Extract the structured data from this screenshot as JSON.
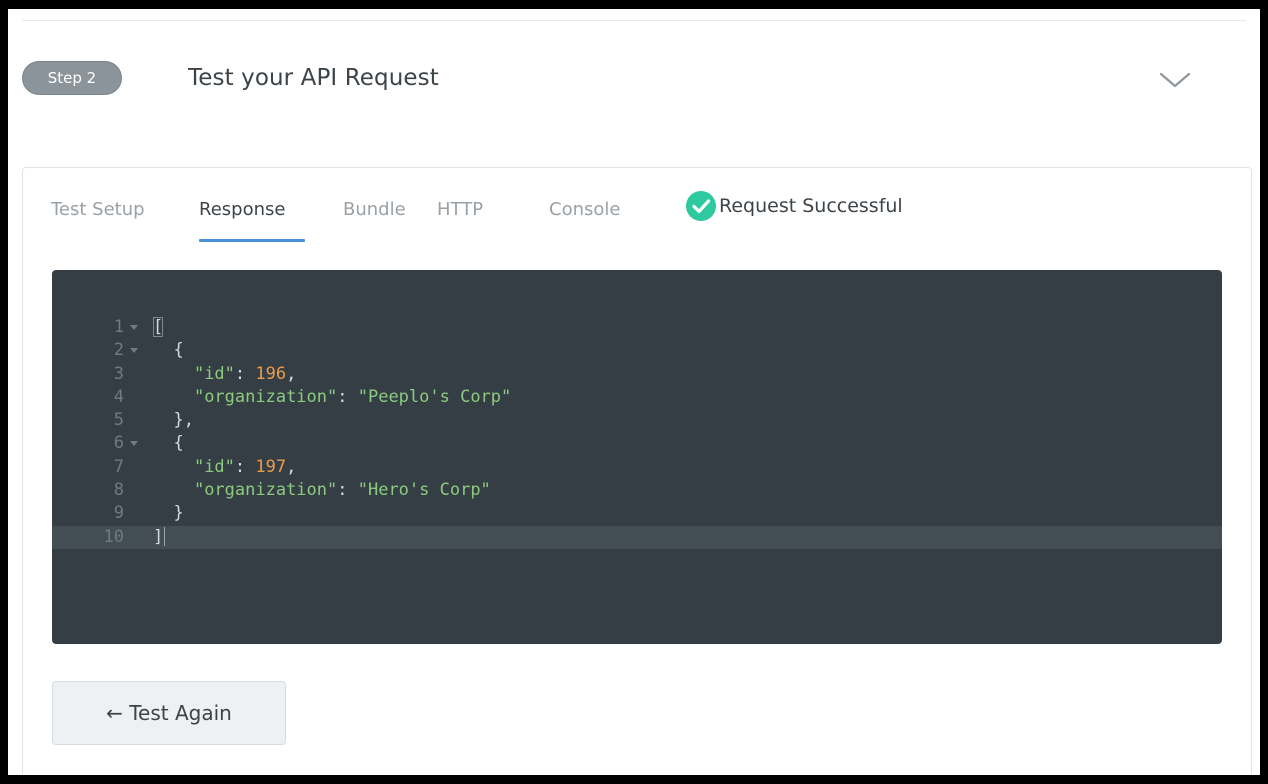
{
  "header": {
    "step_label": "Step 2",
    "title": "Test your API Request",
    "collapse_icon": "chevron-down-icon"
  },
  "tabs": [
    {
      "label": "Test Setup",
      "active": false
    },
    {
      "label": "Response",
      "active": true
    },
    {
      "label": "Bundle",
      "active": false
    },
    {
      "label": "HTTP",
      "active": false
    },
    {
      "label": "Console",
      "active": false
    }
  ],
  "status": {
    "icon": "check-circle-icon",
    "text": "Request Successful"
  },
  "code": {
    "current_line": 10,
    "lines": [
      {
        "number": "1",
        "foldable": true,
        "tokens": [
          {
            "t": "[",
            "c": "bracket-hl"
          }
        ]
      },
      {
        "number": "2",
        "foldable": true,
        "tokens": [
          {
            "t": "  {",
            "c": "punc"
          }
        ]
      },
      {
        "number": "3",
        "foldable": false,
        "tokens": [
          {
            "t": "    ",
            "c": "punc"
          },
          {
            "t": "\"id\"",
            "c": "key"
          },
          {
            "t": ": ",
            "c": "punc"
          },
          {
            "t": "196",
            "c": "num"
          },
          {
            "t": ",",
            "c": "punc"
          }
        ]
      },
      {
        "number": "4",
        "foldable": false,
        "tokens": [
          {
            "t": "    ",
            "c": "punc"
          },
          {
            "t": "\"organization\"",
            "c": "key"
          },
          {
            "t": ": ",
            "c": "punc"
          },
          {
            "t": "\"Peeplo's Corp\"",
            "c": "str"
          }
        ]
      },
      {
        "number": "5",
        "foldable": false,
        "tokens": [
          {
            "t": "  },",
            "c": "punc"
          }
        ]
      },
      {
        "number": "6",
        "foldable": true,
        "tokens": [
          {
            "t": "  {",
            "c": "punc"
          }
        ]
      },
      {
        "number": "7",
        "foldable": false,
        "tokens": [
          {
            "t": "    ",
            "c": "punc"
          },
          {
            "t": "\"id\"",
            "c": "key"
          },
          {
            "t": ": ",
            "c": "punc"
          },
          {
            "t": "197",
            "c": "num"
          },
          {
            "t": ",",
            "c": "punc"
          }
        ]
      },
      {
        "number": "8",
        "foldable": false,
        "tokens": [
          {
            "t": "    ",
            "c": "punc"
          },
          {
            "t": "\"organization\"",
            "c": "key"
          },
          {
            "t": ": ",
            "c": "punc"
          },
          {
            "t": "\"Hero's Corp\"",
            "c": "str"
          }
        ]
      },
      {
        "number": "9",
        "foldable": false,
        "tokens": [
          {
            "t": "  }",
            "c": "punc"
          }
        ]
      },
      {
        "number": "10",
        "foldable": false,
        "tokens": [
          {
            "t": "]",
            "c": "punc"
          }
        ]
      }
    ]
  },
  "actions": {
    "test_again_label": "← Test Again"
  },
  "colors": {
    "accent": "#4a90d9",
    "success": "#2ec99e",
    "editor_bg": "#353e45",
    "json_string": "#8ccb7e",
    "json_number": "#ec9b49"
  }
}
